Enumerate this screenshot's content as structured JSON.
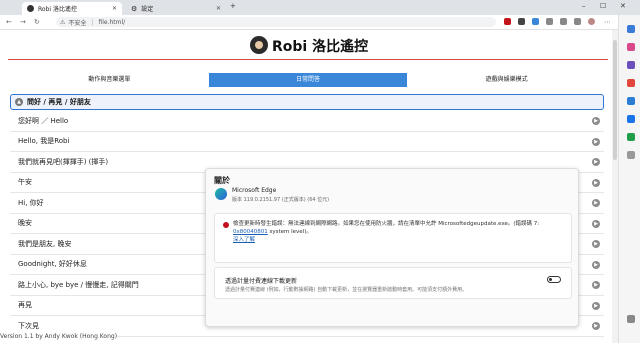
{
  "browser": {
    "tabs": [
      {
        "label": "Robi 洛比遙控",
        "icon": "robot-favicon-icon"
      },
      {
        "label": "設定",
        "icon": "gear-icon"
      }
    ],
    "address": {
      "security": "不安全",
      "url": "file.html/"
    }
  },
  "site": {
    "brand": "Robi 洛比遙控",
    "nav": [
      "動作與音樂選單",
      "日常問答",
      "遊戲與娛樂模式"
    ],
    "section_title": "問好 / 再見 / 好朋友",
    "rows": [
      "您好啊 ／ Hello",
      "Hello, 我是Robi",
      "我們就再見吧(揮揮手) (揮手)",
      "午安",
      "Hi, 你好",
      "晚安",
      "我們是朋友, 晚安",
      "Goodnight, 好好休息",
      "路上小心, bye bye / 慢慢走, 記得關門",
      "再見",
      "下次見"
    ],
    "footer": "Version 1.1 by Andy Kwok (Hong Kong)"
  },
  "about": {
    "title": "關於",
    "product": "Microsoft Edge",
    "version": "版本 119.0.2151.97 (正式版本) (64 位元)",
    "error_text": "檢查更新時發生錯誤：無法連線到網際網路。如果您在使用防火牆，請在清單中允許 Microsoftedgeupdate.exe。(錯誤碼 7: ",
    "error_code": "0x80040801",
    "error_tail": " system level)。",
    "learn_more": "深入了解",
    "toggle_label": "透過計量付費連線下載更新",
    "toggle_sub": "透過計量付費連線 (例如，行動數據網路) 自動下載更新，並在瀏覽器重新啟動時套用。可能須支付額外費用。"
  },
  "colors": {
    "accent": "#3a87d9",
    "error": "#c50f1f"
  }
}
